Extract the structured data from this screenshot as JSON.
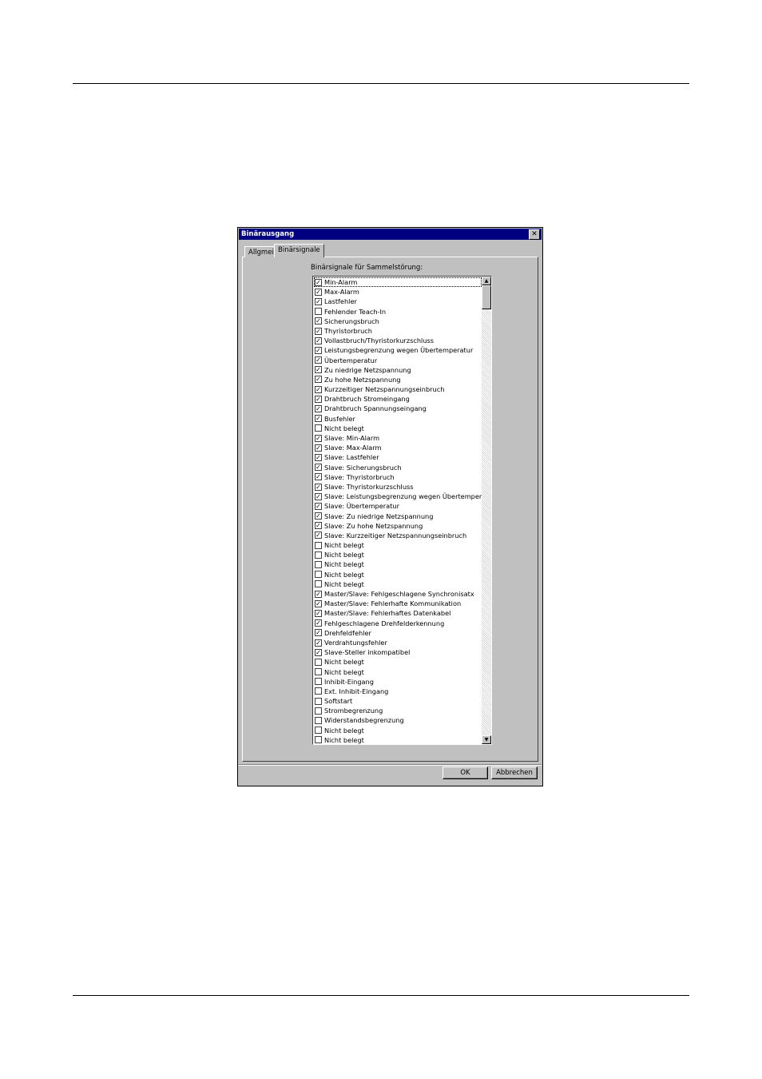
{
  "window": {
    "title": "Binärausgang",
    "close_label": "✕"
  },
  "tabs": [
    {
      "label": "Allgmein",
      "active": false
    },
    {
      "label": "Binärsignale",
      "active": true
    }
  ],
  "list": {
    "label": "Binärsignale für Sammelstörung:",
    "items": [
      {
        "label": "Min-Alarm",
        "checked": true
      },
      {
        "label": "Max-Alarm",
        "checked": true
      },
      {
        "label": "Lastfehler",
        "checked": true
      },
      {
        "label": "Fehlender Teach-In",
        "checked": false
      },
      {
        "label": "Sicherungsbruch",
        "checked": true
      },
      {
        "label": "Thyristorbruch",
        "checked": true
      },
      {
        "label": "Vollastbruch/Thyristorkurzschluss",
        "checked": true
      },
      {
        "label": "Leistungsbegrenzung wegen Übertemperatur",
        "checked": true
      },
      {
        "label": "Übertemperatur",
        "checked": true
      },
      {
        "label": "Zu niedrige Netzspannung",
        "checked": true
      },
      {
        "label": "Zu hohe Netzspannung",
        "checked": true
      },
      {
        "label": "Kurzzeitiger Netzspannungseinbruch",
        "checked": true
      },
      {
        "label": "Drahtbruch Stromeingang",
        "checked": true
      },
      {
        "label": "Drahtbruch Spannungseingang",
        "checked": true
      },
      {
        "label": "Busfehler",
        "checked": true
      },
      {
        "label": "Nicht belegt",
        "checked": false
      },
      {
        "label": "Slave: Min-Alarm",
        "checked": true
      },
      {
        "label": "Slave: Max-Alarm",
        "checked": true
      },
      {
        "label": "Slave: Lastfehler",
        "checked": true
      },
      {
        "label": "Slave: Sicherungsbruch",
        "checked": true
      },
      {
        "label": "Slave: Thyristorbruch",
        "checked": true
      },
      {
        "label": "Slave: Thyristorkurzschluss",
        "checked": true
      },
      {
        "label": "Slave: Leistungsbegrenzung wegen Übertemperatur",
        "checked": true
      },
      {
        "label": "Slave: Übertemperatur",
        "checked": true
      },
      {
        "label": "Slave: Zu niedrige Netzspannung",
        "checked": true
      },
      {
        "label": "Slave: Zu hohe Netzspannung",
        "checked": true
      },
      {
        "label": "Slave: Kurzzeitiger Netzspannungseinbruch",
        "checked": true
      },
      {
        "label": "Nicht belegt",
        "checked": false
      },
      {
        "label": "Nicht belegt",
        "checked": false
      },
      {
        "label": "Nicht belegt",
        "checked": false
      },
      {
        "label": "Nicht belegt",
        "checked": false
      },
      {
        "label": "Nicht belegt",
        "checked": false
      },
      {
        "label": "Master/Slave: Fehlgeschlagene Synchronisatx",
        "checked": true
      },
      {
        "label": "Master/Slave: Fehlerhafte Kommunikation",
        "checked": true
      },
      {
        "label": "Master/Slave: Fehlerhaftes Datenkabel",
        "checked": true
      },
      {
        "label": "Fehlgeschlagene Drehfelderkennung",
        "checked": true
      },
      {
        "label": "Drehfeldfehler",
        "checked": true
      },
      {
        "label": "Verdrahtungsfehler",
        "checked": true
      },
      {
        "label": "Slave-Steller inkompatibel",
        "checked": true
      },
      {
        "label": "Nicht belegt",
        "checked": false
      },
      {
        "label": "Nicht belegt",
        "checked": false
      },
      {
        "label": "Inhibit-Eingang",
        "checked": false
      },
      {
        "label": "Ext. Inhibit-Eingang",
        "checked": false
      },
      {
        "label": "Softstart",
        "checked": false
      },
      {
        "label": "Strombegrenzung",
        "checked": false
      },
      {
        "label": "Widerstandsbegrenzung",
        "checked": false
      },
      {
        "label": "Nicht belegt",
        "checked": false
      },
      {
        "label": "Nicht belegt",
        "checked": false
      }
    ]
  },
  "buttons": {
    "ok": "OK",
    "cancel": "Abbrechen"
  }
}
